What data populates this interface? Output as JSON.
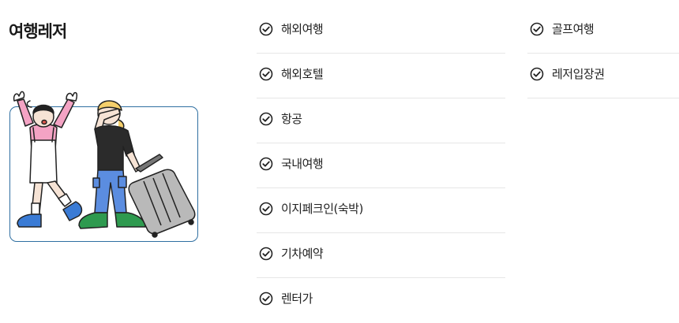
{
  "section": {
    "title": "여행레저"
  },
  "col1": {
    "items": [
      {
        "label": "해외여행"
      },
      {
        "label": "해외호텔"
      },
      {
        "label": "항공"
      },
      {
        "label": "국내여행"
      },
      {
        "label": "이지페크인(숙박)"
      },
      {
        "label": "기차예약"
      },
      {
        "label": "렌터가"
      }
    ]
  },
  "col2": {
    "items": [
      {
        "label": "골프여행"
      },
      {
        "label": "레저입장권"
      }
    ]
  },
  "icons": {
    "check": "check-circle-icon"
  },
  "colors": {
    "border": "#2f6fa1",
    "divider": "#e6e6e6"
  }
}
